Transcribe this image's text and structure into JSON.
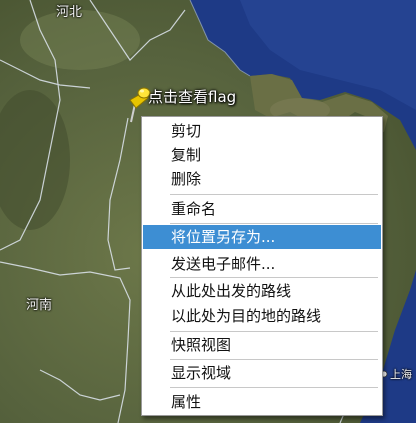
{
  "map": {
    "labels": {
      "hebei": "河北",
      "henan": "河南",
      "shanghai": "上海"
    },
    "colors": {
      "sea": "#1e3a86",
      "land": "#5b6740",
      "border": "#dfe6f0"
    }
  },
  "placemark": {
    "label": "点击查看flag",
    "icon": "yellow-pushpin-icon"
  },
  "context_menu": {
    "items": [
      {
        "label": "剪切",
        "highlighted": false
      },
      {
        "label": "复制",
        "highlighted": false
      },
      {
        "label": "删除",
        "highlighted": false
      },
      {
        "label": "重命名",
        "highlighted": false
      },
      {
        "label": "将位置另存为...",
        "highlighted": true
      },
      {
        "label": "发送电子邮件...",
        "highlighted": false
      },
      {
        "label": "从此处出发的路线",
        "highlighted": false
      },
      {
        "label": "以此处为目的地的路线",
        "highlighted": false
      },
      {
        "label": "快照视图",
        "highlighted": false
      },
      {
        "label": "显示视域",
        "highlighted": false
      },
      {
        "label": "属性",
        "highlighted": false
      }
    ],
    "highlight_color": "#3d8ed3"
  }
}
